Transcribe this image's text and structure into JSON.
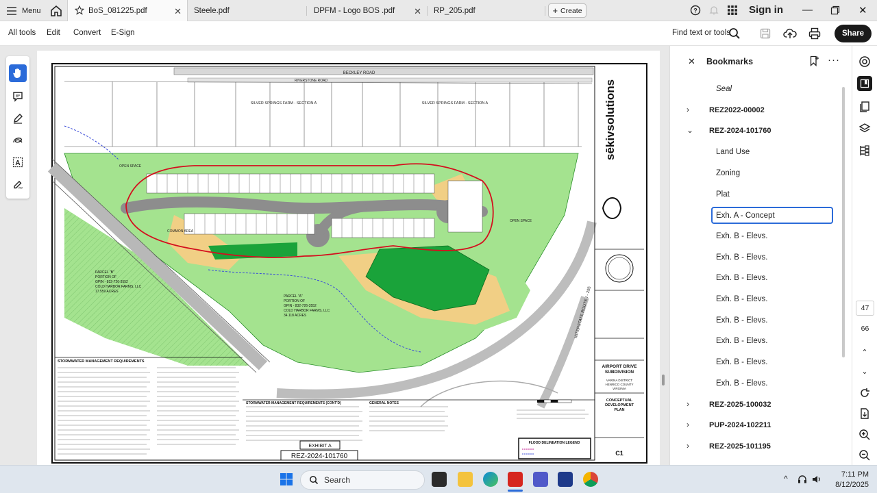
{
  "titlebar": {
    "menu_label": "Menu",
    "tabs": [
      {
        "label": "BoS_081225.pdf",
        "active": true
      },
      {
        "label": "Steele.pdf",
        "active": false
      },
      {
        "label": "DPFM - Logo BOS .pdf",
        "active": false
      },
      {
        "label": "RP_205.pdf",
        "active": false
      }
    ],
    "create_label": "Create",
    "signin_label": "Sign in"
  },
  "toolbar": {
    "menus": [
      "All tools",
      "Edit",
      "Convert",
      "E-Sign"
    ],
    "find_label": "Find text or tools",
    "share_label": "Share"
  },
  "document": {
    "stamp_exhibit": "EXHIBIT A",
    "stamp_case": "REZ-2024-101760",
    "project_title": "AIRPORT DRIVE SUBDIVISION",
    "project_sub": "VARINA DISTRICT HENRICO COUNTY VIRGINIA",
    "sheet_title": "CONCEPTUAL DEVELOPMENT PLAN",
    "sheet_no": "C1",
    "firm": "sēkivsolutions",
    "road_1": "BECKLEY ROAD",
    "road_2": "RIVERSTONE ROAD",
    "section": "SILVER SPRINGS FARM - SECTION A",
    "interstate": "INTERSTATE ROUTE I - 295",
    "parcel_b": "PARCEL \"B\" PORTION OF GPIN - 832-726-3552 N/F COLD HARBOR FARMS, LLC 17.559 ACRES ZONED - A-1",
    "parcel_a": "PARCEL \"A\" PORTION OF GPIN - 832-726-3552 N/F COLD HARBOR FARMS, LLC 34.118 ACRES ZONED - A-1",
    "notes_1": "STORMWATER MANAGEMENT REQUIREMENTS",
    "notes_2": "STORMWATER MANAGEMENT REQUIREMENTS (CONT'D)",
    "notes_3": "GENERAL NOTES",
    "legend": "FLOOD DELINEATION LEGEND",
    "open_space": "OPEN SPACE",
    "common_area": "COMMON AREA"
  },
  "bookmarks": {
    "title": "Bookmarks",
    "items": [
      {
        "label": "Seal",
        "level": 1,
        "italic": true
      },
      {
        "label": "REZ2022-00002",
        "level": 0,
        "state": "collapsed"
      },
      {
        "label": "REZ-2024-101760",
        "level": 0,
        "state": "expanded"
      },
      {
        "label": "Land Use",
        "level": 1
      },
      {
        "label": "Zoning",
        "level": 1
      },
      {
        "label": "Plat",
        "level": 1
      },
      {
        "label": "Exh. A - Concept",
        "level": 1,
        "selected": true
      },
      {
        "label": "Exh. B - Elevs.",
        "level": 1
      },
      {
        "label": "Exh. B - Elevs.",
        "level": 1
      },
      {
        "label": "Exh. B - Elevs.",
        "level": 1
      },
      {
        "label": "Exh. B - Elevs.",
        "level": 1
      },
      {
        "label": "Exh. B - Elevs.",
        "level": 1
      },
      {
        "label": "Exh. B - Elevs.",
        "level": 1
      },
      {
        "label": "Exh. B - Elevs.",
        "level": 1
      },
      {
        "label": "Exh. B - Elevs.",
        "level": 1
      },
      {
        "label": "REZ-2025-100032",
        "level": 0,
        "state": "collapsed"
      },
      {
        "label": "PUP-2024-102211",
        "level": 0,
        "state": "collapsed"
      },
      {
        "label": "REZ-2025-101195",
        "level": 0,
        "state": "collapsed"
      }
    ]
  },
  "rail": {
    "page_current": "47",
    "page_total": "66"
  },
  "taskbar": {
    "search_label": "Search",
    "time": "7:11 PM",
    "date": "8/12/2025"
  },
  "colors": {
    "accent": "#2b6bd9",
    "green_light": "#9be28a",
    "green_dark": "#1aa33a",
    "tan": "#f1cf85",
    "boundary_red": "#d40f1e"
  }
}
